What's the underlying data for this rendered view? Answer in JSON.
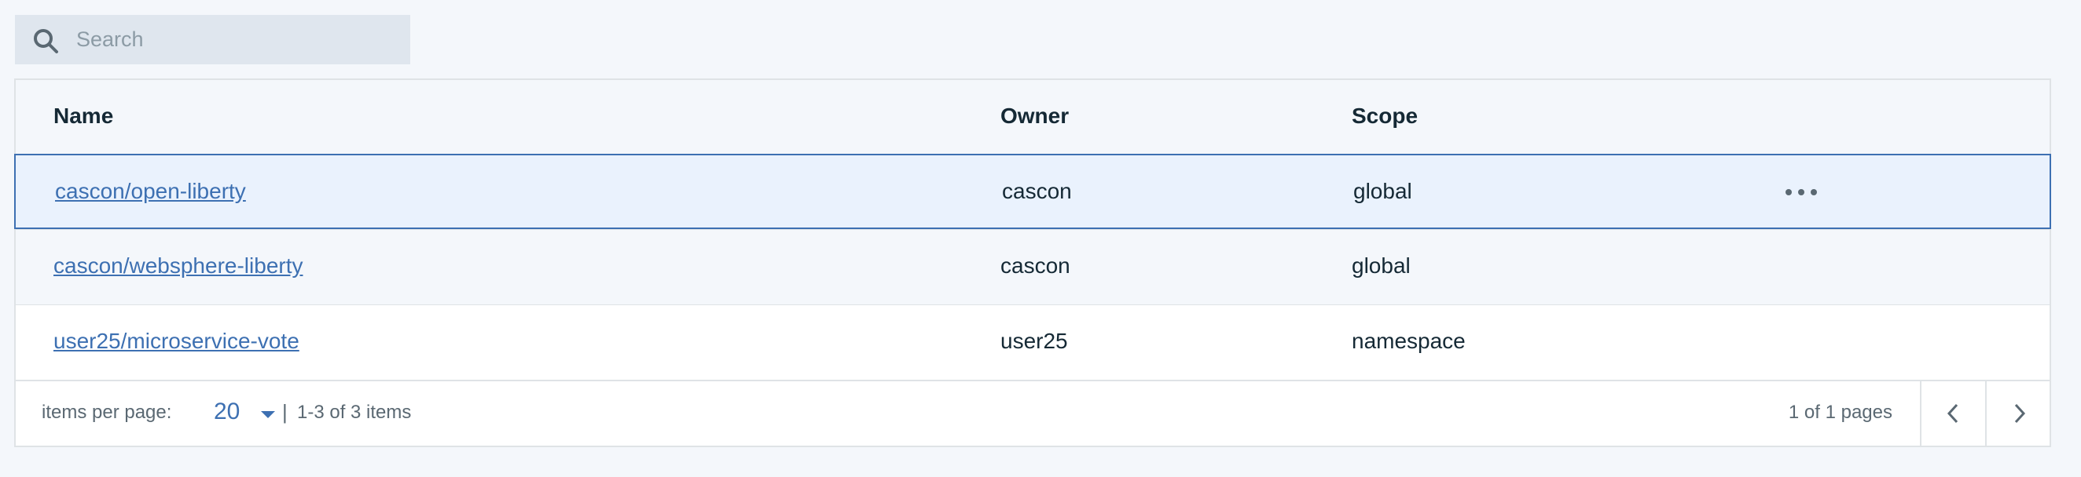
{
  "search": {
    "placeholder": "Search",
    "icon": "search-icon"
  },
  "table": {
    "columns": [
      "Name",
      "Owner",
      "Scope"
    ],
    "rows": [
      {
        "name": "cascon/open-liberty",
        "owner": "cascon",
        "scope": "global",
        "selected": true
      },
      {
        "name": "cascon/websphere-liberty",
        "owner": "cascon",
        "scope": "global",
        "selected": false
      },
      {
        "name": "user25/microservice-vote",
        "owner": "user25",
        "scope": "namespace",
        "selected": false
      }
    ],
    "row_action_icon": "overflow-menu-icon"
  },
  "pagination": {
    "items_per_page_label": "items per page:",
    "items_per_page_value": "20",
    "separator": "|",
    "range_text": "1-3 of 3 items",
    "pages_text": "1 of 1 pages",
    "prev_icon": "chevron-left-icon",
    "next_icon": "chevron-right-icon"
  },
  "colors": {
    "link": "#3d70b2",
    "selected_bg": "#eaf2fd",
    "selected_border": "#3d70b2",
    "page_bg": "#f4f7fb",
    "search_bg": "#dfe6ee"
  }
}
